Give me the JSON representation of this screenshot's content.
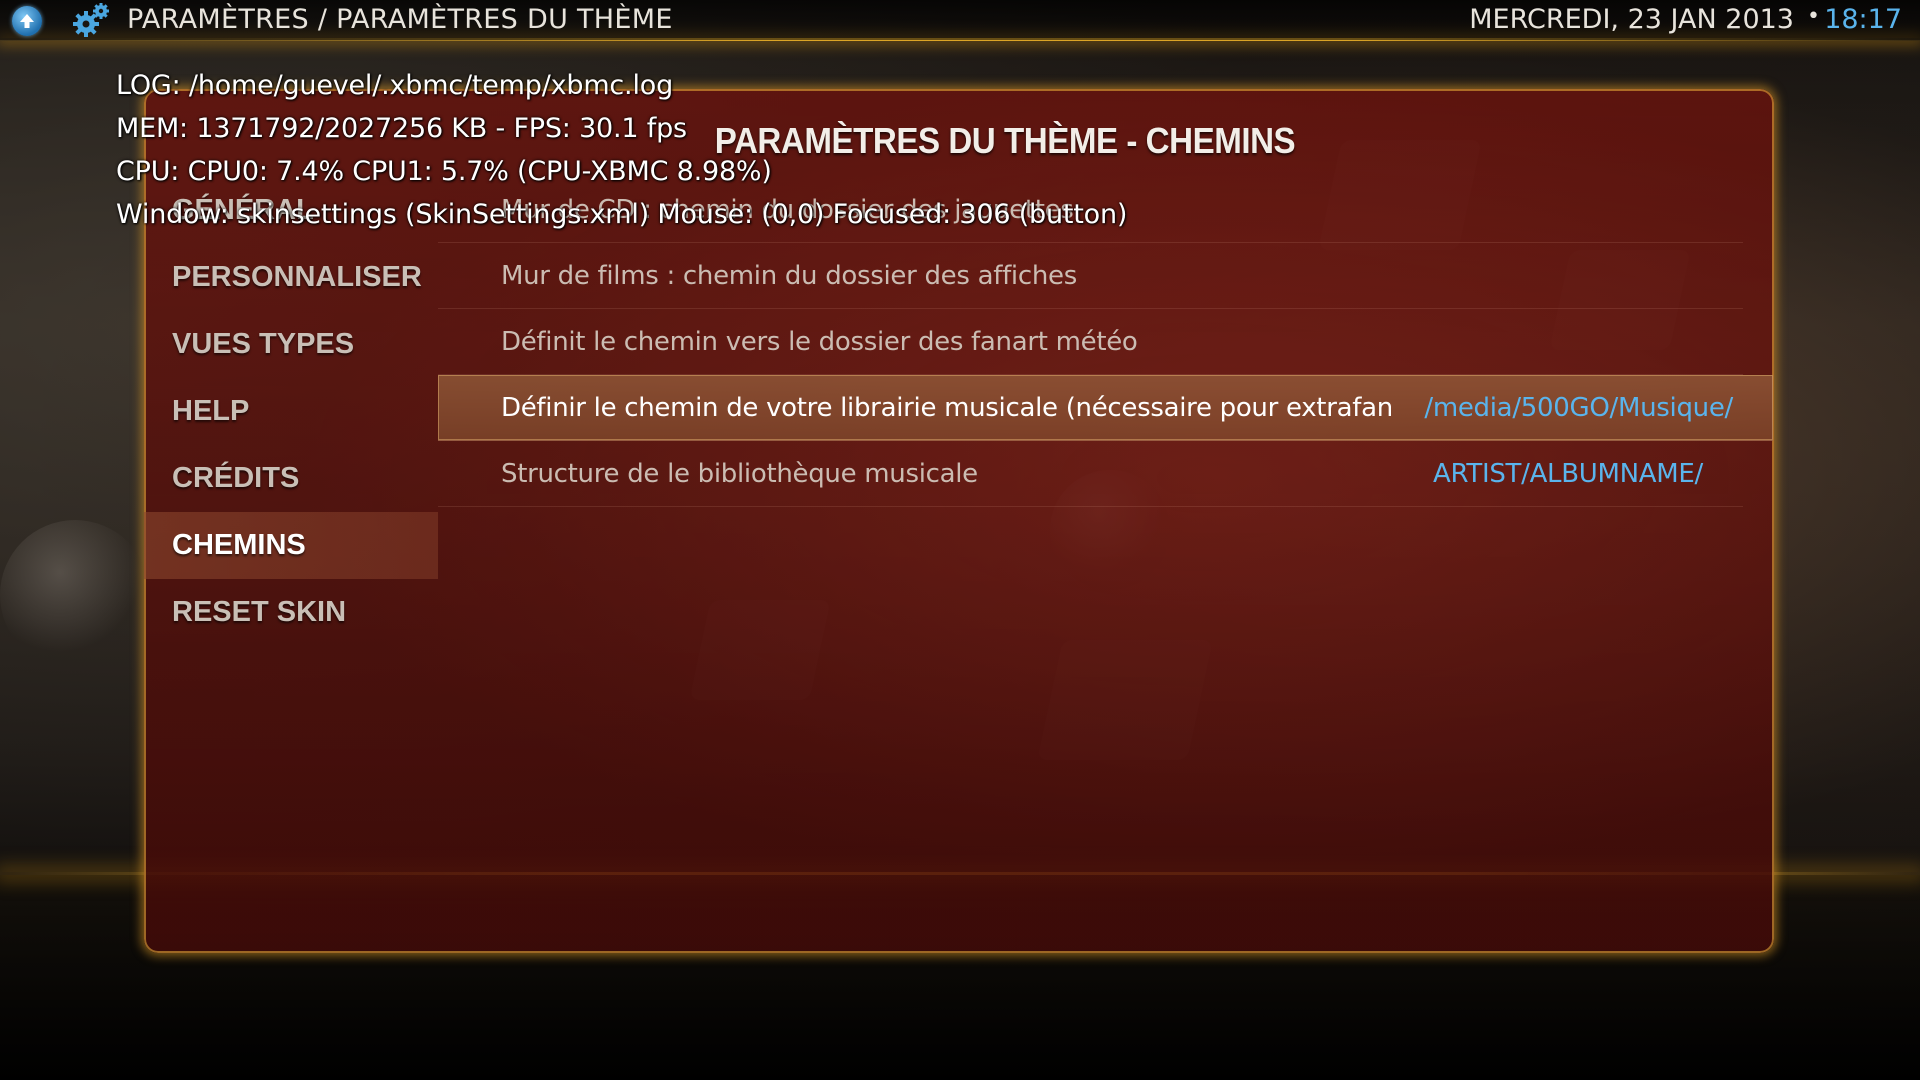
{
  "topbar": {
    "home_icon": "arrow-up-circle-icon",
    "settings_icon": "gears-icon",
    "breadcrumb": "PARAMÈTRES / PARAMÈTRES DU THÈME",
    "date": "MERCREDI, 23 JAN 2013",
    "separator": "•",
    "time": "18:17"
  },
  "debug": {
    "log": "LOG: /home/guevel/.xbmc/temp/xbmc.log",
    "mem": "MEM: 1371792/2027256 KB - FPS: 30.1 fps",
    "cpu": "CPU: CPU0: 7.4% CPU1: 5.7%  (CPU-XBMC 8.98%)",
    "window": "Window: skinsettings (SkinSettings.xml)  Mouse: (0,0)  Focused: 306 (button)"
  },
  "panel": {
    "title": "PARAMÈTRES DU THÈME - CHEMINS"
  },
  "menu": {
    "items": [
      {
        "label": "GÉNÉRAL"
      },
      {
        "label": "PERSONNALISER"
      },
      {
        "label": "VUES TYPES"
      },
      {
        "label": "HELP"
      },
      {
        "label": "CRÉDITS"
      },
      {
        "label": "CHEMINS"
      },
      {
        "label": "RESET SKIN"
      }
    ],
    "selected": "CHEMINS"
  },
  "settings": {
    "rows": [
      {
        "label": "Mur de CD : chemin du dossier des jaquettes",
        "value": ""
      },
      {
        "label": "Mur de films : chemin du dossier des affiches",
        "value": ""
      },
      {
        "label": "Définit le chemin vers le dossier des fanart météo",
        "value": ""
      },
      {
        "label": "Définir le chemin de votre librairie musicale (nécessaire pour extrafanart, c",
        "value": "/media/500GO/Musique/"
      },
      {
        "label": "Structure de le bibliothèque musicale",
        "value": "ARTIST/ALBUMNAME/"
      }
    ],
    "focused_index": 3
  },
  "colors": {
    "accent_blue": "#5ab4ec",
    "panel_red": "#6e140e",
    "glow_gold": "#f0b428"
  }
}
